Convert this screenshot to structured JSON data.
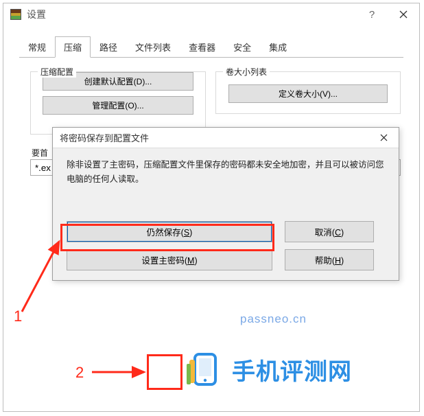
{
  "window": {
    "title": "设置",
    "help_tooltip": "帮助",
    "close_tooltip": "关闭"
  },
  "tabs": [
    {
      "label": "常规",
      "active": false
    },
    {
      "label": "压缩",
      "active": true
    },
    {
      "label": "路径",
      "active": false
    },
    {
      "label": "文件列表",
      "active": false
    },
    {
      "label": "查看器",
      "active": false
    },
    {
      "label": "安全",
      "active": false
    },
    {
      "label": "集成",
      "active": false
    }
  ],
  "compress_group": {
    "legend": "压缩配置",
    "create_default_btn": "创建默认配置(D)...",
    "manage_btn": "管理配置(O)..."
  },
  "volumes_group": {
    "legend": "卷大小列表",
    "define_btn": "定义卷大小(V)..."
  },
  "priority": {
    "label": "要首",
    "value": "*.ex"
  },
  "modal": {
    "title": "将密码保存到配置文件",
    "message": "除非设置了主密码，压缩配置文件里保存的密码都未安全地加密，并且可以被访问您电脑的任何人读取。",
    "save_anyway": {
      "text": "仍然保存",
      "accel": "S"
    },
    "cancel": {
      "text": "取消",
      "accel": "C"
    },
    "set_master": {
      "text": "设置主密码",
      "accel": "M"
    },
    "help": {
      "text": "帮助",
      "accel": "H"
    }
  },
  "annotations": {
    "step1": "1",
    "step2": "2"
  },
  "watermark": {
    "url": "passneo.cn",
    "brand": "手机评测网"
  },
  "icons": {
    "help": "help-icon",
    "close": "close-icon",
    "app": "winrar-icon"
  }
}
